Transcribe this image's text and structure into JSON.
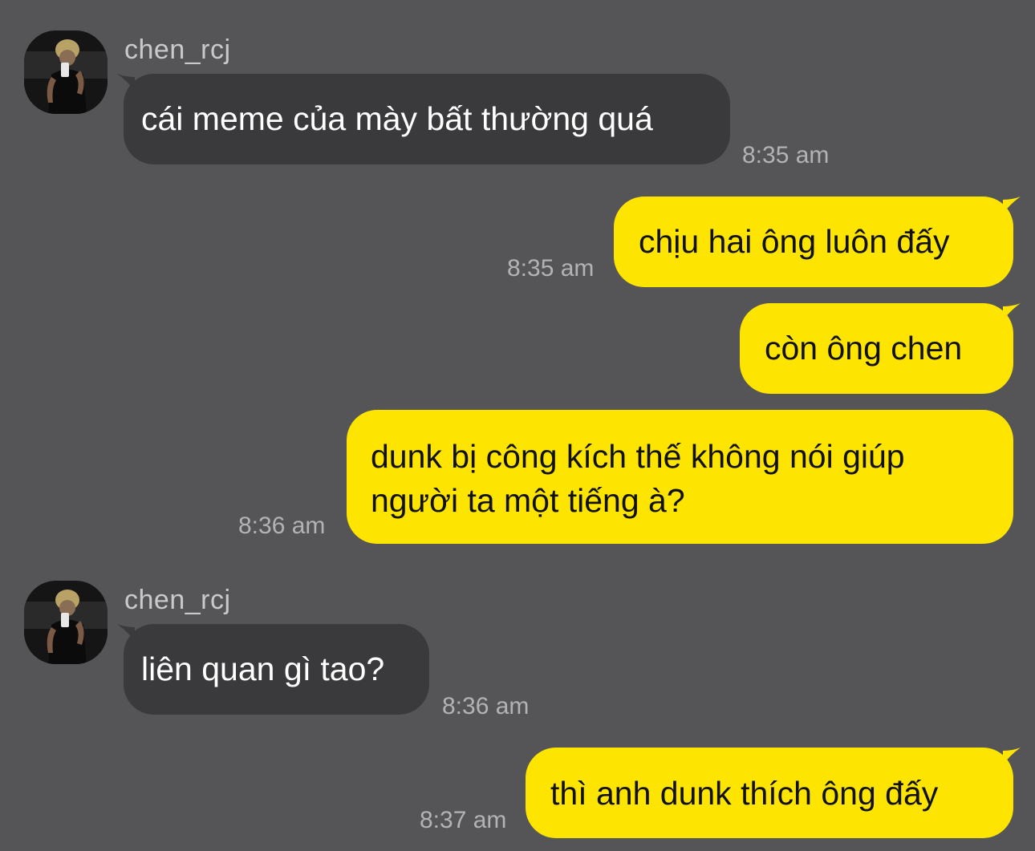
{
  "colors": {
    "background": "#555456",
    "incoming_bubble": "#3a393b",
    "outgoing_bubble": "#fde401",
    "sender_text": "#c9c9cb",
    "timestamp_text": "#b3b2b4"
  },
  "messages": [
    {
      "sender": "chen_rcj",
      "text": "cái meme của mày bất thường quá",
      "time": "8:35 am",
      "direction": "incoming"
    },
    {
      "text": "chịu hai ông luôn đấy",
      "time": "8:35 am",
      "direction": "outgoing"
    },
    {
      "text": "còn ông chen",
      "direction": "outgoing"
    },
    {
      "text_line1": "dunk bị công kích thế không nói giúp",
      "text_line2": "người ta một tiếng à?",
      "time": "8:36 am",
      "direction": "outgoing"
    },
    {
      "sender": "chen_rcj",
      "text": "liên quan gì tao?",
      "time": "8:36 am",
      "direction": "incoming"
    },
    {
      "text": "thì anh dunk thích ông đấy",
      "time": "8:37 am",
      "direction": "outgoing"
    }
  ]
}
